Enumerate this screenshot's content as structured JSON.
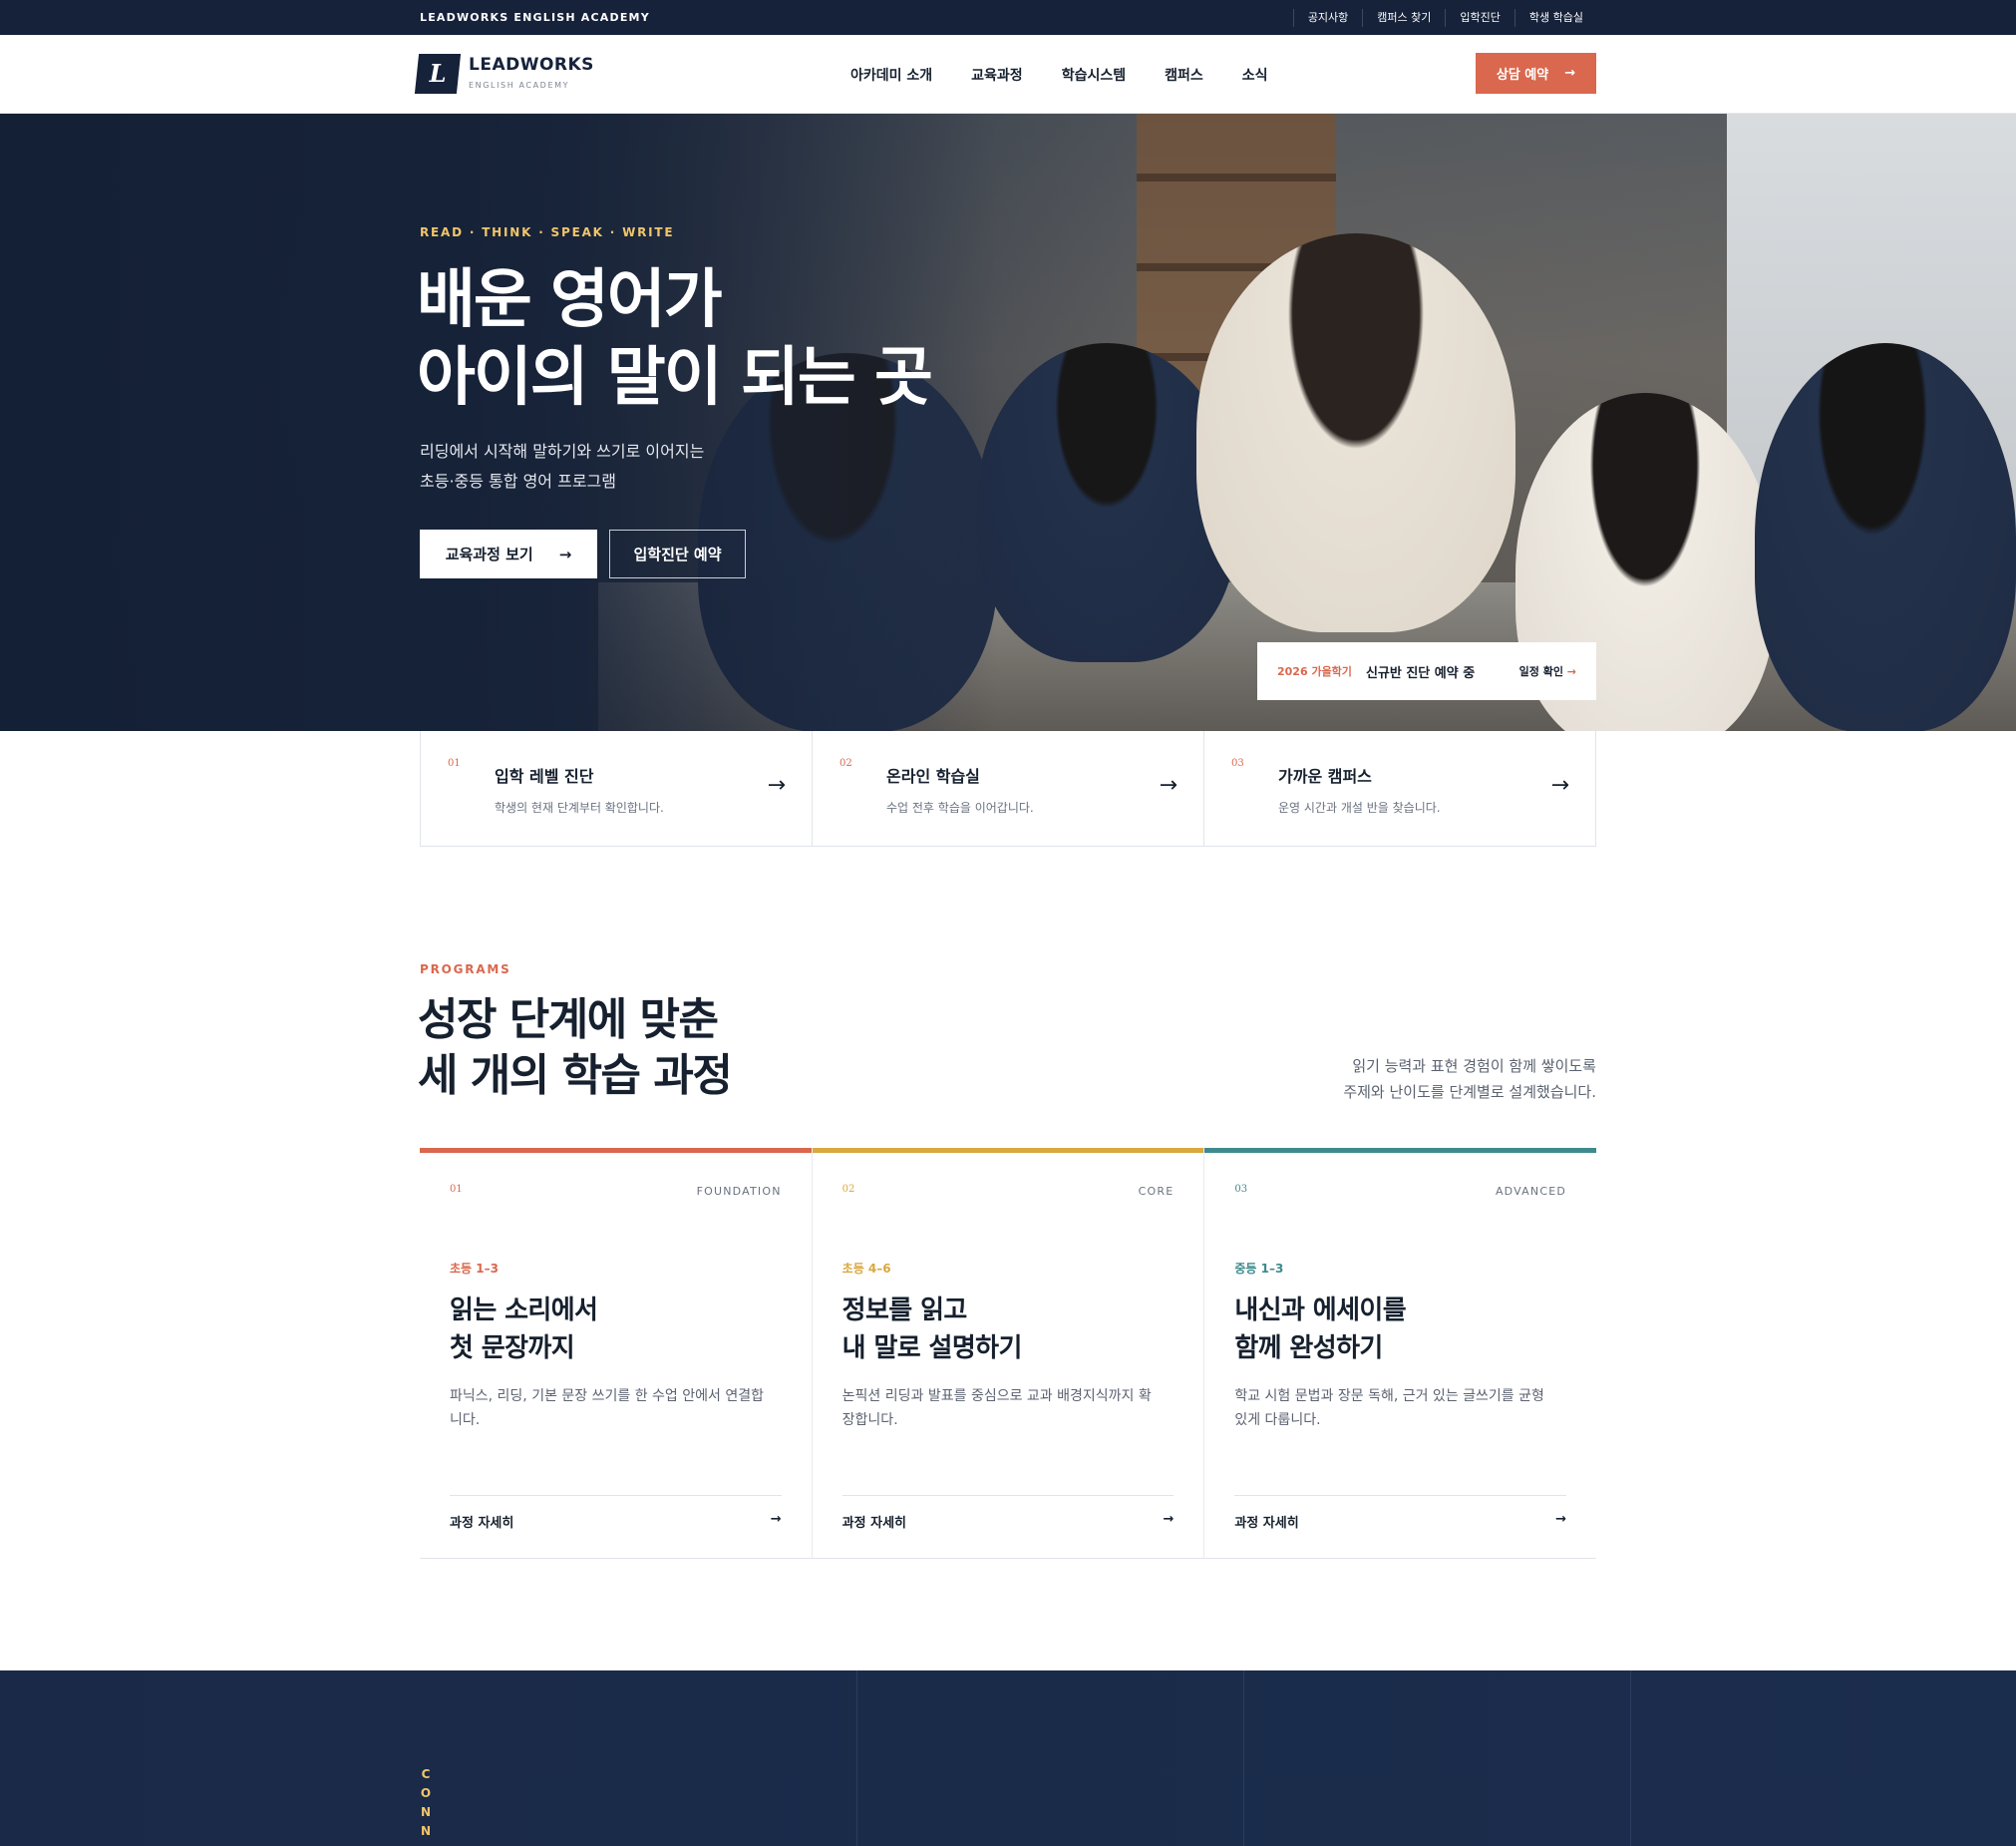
{
  "topbar": {
    "brand": "LEADWORKS ENGLISH ACADEMY",
    "links": [
      "공지사항",
      "캠퍼스 찾기",
      "입학진단",
      "학생 학습실"
    ]
  },
  "header": {
    "logo_letter": "L",
    "logo_name": "LEADWORKS",
    "logo_sub": "ENGLISH ACADEMY",
    "nav": [
      "아카데미 소개",
      "교육과정",
      "학습시스템",
      "캠퍼스",
      "소식"
    ],
    "cta_label": "상담 예약",
    "cta_arrow": "→"
  },
  "hero": {
    "tagline": "READ · THINK · SPEAK · WRITE",
    "title_line1": "배운 영어가",
    "title_line2": "아이의 말이 되는 곳",
    "desc_line1": "리딩에서 시작해 말하기와 쓰기로 이어지는",
    "desc_line2": "초등·중등 통합 영어 프로그램",
    "primary_button": "교육과정 보기",
    "primary_arrow": "→",
    "secondary_button": "입학진단 예약",
    "notice": {
      "tag": "2026 가을학기",
      "text": "신규반 진단 예약 중",
      "link": "일정 확인",
      "link_arrow": "→"
    }
  },
  "quick_links": [
    {
      "num": "01",
      "title": "입학 레벨 진단",
      "desc": "학생의 현재 단계부터 확인합니다.",
      "arrow": "→"
    },
    {
      "num": "02",
      "title": "온라인 학습실",
      "desc": "수업 전후 학습을 이어갑니다.",
      "arrow": "→"
    },
    {
      "num": "03",
      "title": "가까운 캠퍼스",
      "desc": "운영 시간과 개설 반을 찾습니다.",
      "arrow": "→"
    }
  ],
  "programs": {
    "tag": "PROGRAMS",
    "title_line1": "성장 단계에 맞춘",
    "title_line2": "세 개의 학습 과정",
    "desc_line1": "읽기 능력과 표현 경험이 함께 쌓이도록",
    "desc_line2": "주제와 난이도를 단계별로 설계했습니다.",
    "cards": [
      {
        "num": "01",
        "level": "FOUNDATION",
        "grade": "초등 1–3",
        "title_line1": "읽는 소리에서",
        "title_line2": "첫 문장까지",
        "desc": "파닉스, 리딩, 기본 문장 쓰기를 한 수업 안에서 연결합니다.",
        "link": "과정 자세히",
        "arrow": "→",
        "color": "#d9684e"
      },
      {
        "num": "02",
        "level": "CORE",
        "grade": "초등 4–6",
        "title_line1": "정보를 읽고",
        "title_line2": "내 말로 설명하기",
        "desc": "논픽션 리딩과 발표를 중심으로 교과 배경지식까지 확장합니다.",
        "link": "과정 자세히",
        "arrow": "→",
        "color": "#d9a83e"
      },
      {
        "num": "03",
        "level": "ADVANCED",
        "grade": "중등 1–3",
        "title_line1": "내신과 에세이를",
        "title_line2": "함께 완성하기",
        "desc": "학교 시험 문법과 장문 독해, 근거 있는 글쓰기를 균형 있게 다룹니다.",
        "link": "과정 자세히",
        "arrow": "→",
        "color": "#3f8a8c"
      }
    ]
  },
  "band": {
    "vertical_text": "CONN"
  },
  "colors": {
    "navy": "#16223a",
    "accent": "#d9684e",
    "gold": "#f2c56a"
  }
}
